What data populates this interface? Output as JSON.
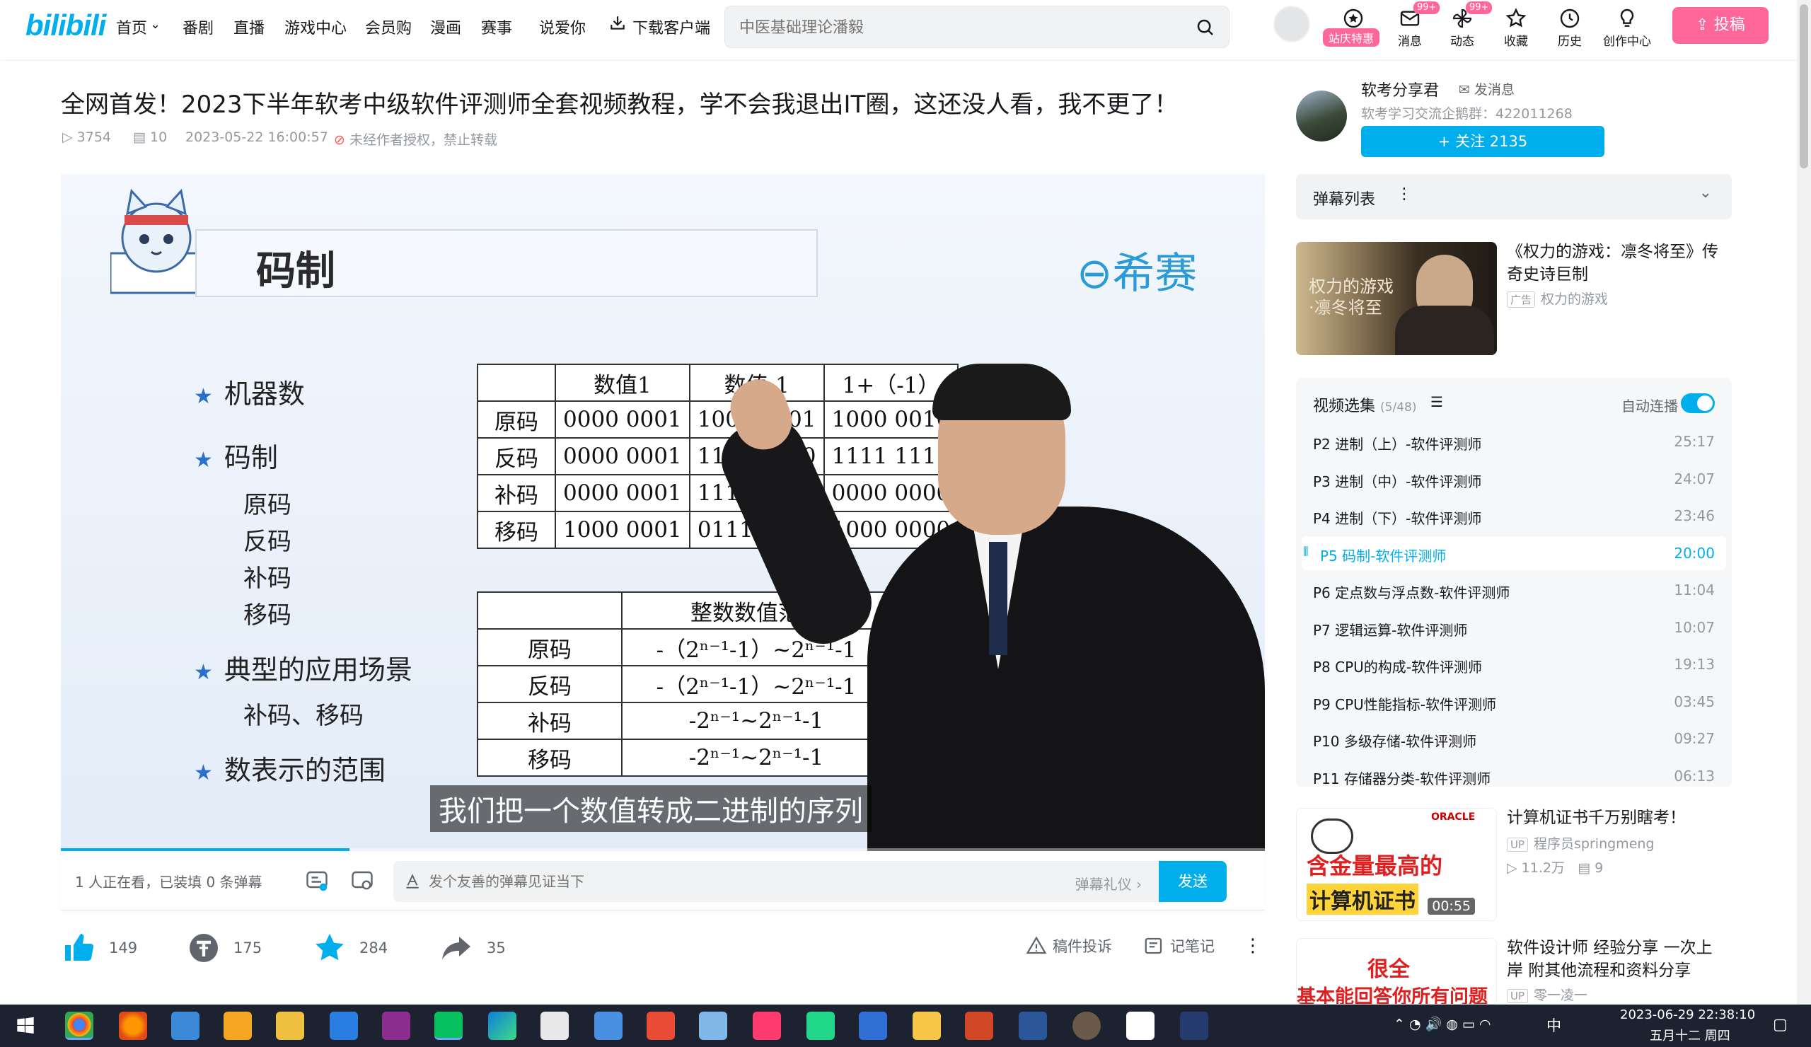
{
  "header": {
    "logo": "bilibili",
    "nav": [
      "首页",
      "番剧",
      "直播",
      "游戏中心",
      "会员购",
      "漫画",
      "赛事",
      "说爱你",
      "下载客户端"
    ],
    "search_placeholder": "中医基础理论潘毅",
    "promo_pill": "站庆特惠",
    "right_icons": [
      {
        "label": "消息",
        "icon": "mail-icon",
        "badge": "99+"
      },
      {
        "label": "动态",
        "icon": "windmill-icon",
        "badge": "99+"
      },
      {
        "label": "收藏",
        "icon": "star-icon"
      },
      {
        "label": "历史",
        "icon": "clock-icon"
      },
      {
        "label": "创作中心",
        "icon": "bulb-icon"
      }
    ],
    "upload_label": "投稿",
    "accent": "#00aeec",
    "pink": "#ff6699"
  },
  "video": {
    "title": "全网首发！2023下半年软考中级软件评测师全套视频教程，学不会我退出IT圈，这还没人看，我不更了！",
    "views": "3754",
    "danmaku_count": "10",
    "date": "2023-05-22 16:00:57",
    "copyright": "未经作者授权，禁止转载"
  },
  "slide": {
    "title": "码制",
    "logo": "希赛",
    "bullets": [
      "机器数",
      "码制",
      "典型的应用场景",
      "数表示的范围"
    ],
    "sub_codes": [
      "原码",
      "反码",
      "补码",
      "移码"
    ],
    "scenario": "补码、移码",
    "table1": {
      "headers": [
        "",
        "数值1",
        "数值-1",
        "1+（-1）"
      ],
      "rows": [
        [
          "原码",
          "0000 0001",
          "1000 0001",
          "1000 0010"
        ],
        [
          "反码",
          "0000 0001",
          "1111 1110",
          "1111 1111"
        ],
        [
          "补码",
          "0000 0001",
          "1111 1111",
          "0000 0000"
        ],
        [
          "移码",
          "1000 0001",
          "0111 1111",
          "1000 0000"
        ]
      ]
    },
    "table2": {
      "header": "整数数值范围",
      "rows": [
        [
          "原码",
          "-（2ⁿ⁻¹-1）~2ⁿ⁻¹-1"
        ],
        [
          "反码",
          "-（2ⁿ⁻¹-1）~2ⁿ⁻¹-1"
        ],
        [
          "补码",
          "-2ⁿ⁻¹~2ⁿ⁻¹-1"
        ],
        [
          "移码",
          "-2ⁿ⁻¹~2ⁿ⁻¹-1"
        ]
      ]
    },
    "subtitle": "我们把一个数值转成二进制的序列",
    "progress": 0.24
  },
  "danmaku_bar": {
    "viewers": "1 人正在看，已装填 0 条弹幕",
    "input_placeholder": "发个友善的弹幕见证当下",
    "etiquette": "弹幕礼仪 ›",
    "send": "发送"
  },
  "actions": {
    "like": "149",
    "coin": "175",
    "fav": "284",
    "share": "35",
    "report": "稿件投诉",
    "notes": "记笔记"
  },
  "uploader": {
    "name": "软考分享君",
    "message": "发消息",
    "desc": "软考学习交流企鹅群：422011268",
    "follow": "+ 关注 2135"
  },
  "danmaku_list": {
    "title": "弹幕列表"
  },
  "ad": {
    "title": "《权力的游戏：凛冬将至》传奇史诗巨制",
    "tag": "广告",
    "source": "权力的游戏",
    "thumb_text": "权力的游戏·凛冬将至"
  },
  "episodes": {
    "title": "视频选集",
    "count": "(5/48)",
    "autoplay": "自动连播",
    "items": [
      {
        "label": "P2  进制（上）-软件评测师",
        "dur": "25:17"
      },
      {
        "label": "P3  进制（中）-软件评测师",
        "dur": "24:07"
      },
      {
        "label": "P4  进制（下）-软件评测师",
        "dur": "23:46"
      },
      {
        "label": "P5  码制-软件评测师",
        "dur": "20:00"
      },
      {
        "label": "P6  定点数与浮点数-软件评测师",
        "dur": "11:04"
      },
      {
        "label": "P7  逻辑运算-软件评测师",
        "dur": "10:07"
      },
      {
        "label": "P8  CPU的构成-软件评测师",
        "dur": "19:13"
      },
      {
        "label": "P9  CPU性能指标-软件评测师",
        "dur": "03:45"
      },
      {
        "label": "P10  多级存储-软件评测师",
        "dur": "09:27"
      },
      {
        "label": "P11  存储器分类-软件评测师",
        "dur": "06:13"
      }
    ],
    "active_index": 3
  },
  "recommend": [
    {
      "title": "计算机证书千万别瞎考！",
      "author": "程序员springmeng",
      "views": "11.2万",
      "danmaku": "9",
      "dur": "00:55",
      "thumb_line1": "含金量最高的",
      "thumb_line2": "计算机证书"
    },
    {
      "title": "软件设计师 经验分享 一次上岸 附其他流程和资料分享",
      "author": "零一凌一",
      "thumb_line1": "很全",
      "thumb_line2": "基本能回答你所有问题"
    }
  ],
  "taskbar": {
    "ime": "中",
    "datetime": "2023-06-29 22:38:10",
    "weekday": "五月十二 周四"
  }
}
